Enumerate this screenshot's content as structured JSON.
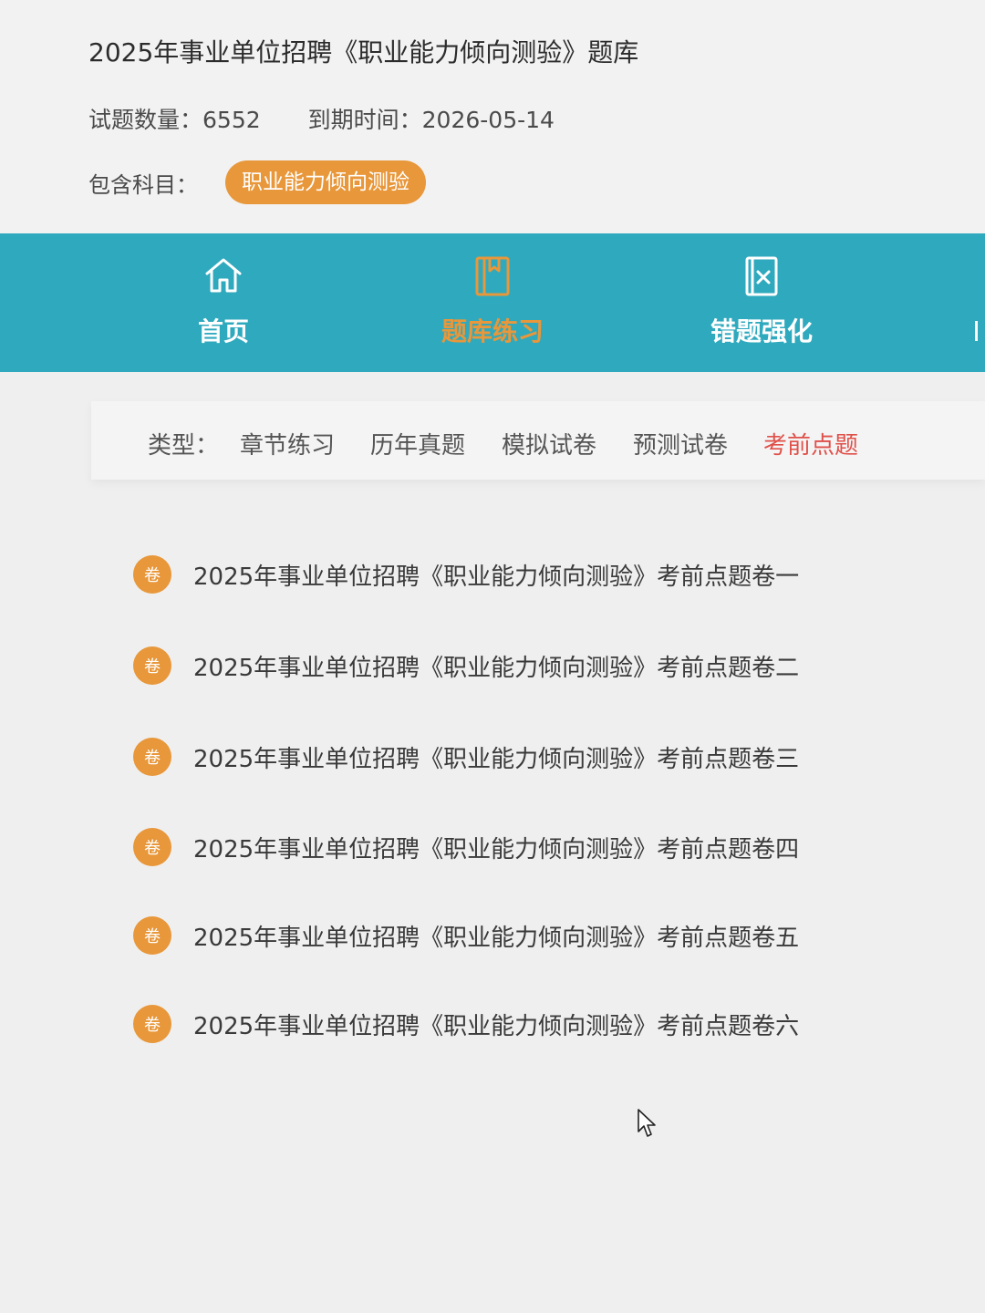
{
  "header": {
    "title": "2025年事业单位招聘《职业能力倾向测验》题库",
    "question_count_label": "试题数量：",
    "question_count_value": "6552",
    "expiry_label": "到期时间：",
    "expiry_value": "2026-05-14",
    "subjects_label": "包含科目：",
    "subject_tag": "职业能力倾向测验"
  },
  "nav": {
    "items": [
      {
        "label": "首页",
        "icon": "home-icon"
      },
      {
        "label": "题库练习",
        "icon": "book-icon",
        "active": true
      },
      {
        "label": "错题强化",
        "icon": "wrong-questions-icon"
      }
    ]
  },
  "filter": {
    "label": "类型：",
    "items": [
      {
        "label": "章节练习"
      },
      {
        "label": "历年真题"
      },
      {
        "label": "模拟试卷"
      },
      {
        "label": "预测试卷"
      },
      {
        "label": "考前点题",
        "active": true
      }
    ]
  },
  "papers": {
    "badge": "卷",
    "items": [
      {
        "title": "2025年事业单位招聘《职业能力倾向测验》考前点题卷一"
      },
      {
        "title": "2025年事业单位招聘《职业能力倾向测验》考前点题卷二"
      },
      {
        "title": "2025年事业单位招聘《职业能力倾向测验》考前点题卷三"
      },
      {
        "title": "2025年事业单位招聘《职业能力倾向测验》考前点题卷四"
      },
      {
        "title": "2025年事业单位招聘《职业能力倾向测验》考前点题卷五"
      },
      {
        "title": "2025年事业单位招聘《职业能力倾向测验》考前点题卷六"
      }
    ]
  },
  "colors": {
    "nav_bg": "#2fa9be",
    "accent_orange": "#e8973a",
    "active_red": "#e0504a"
  }
}
